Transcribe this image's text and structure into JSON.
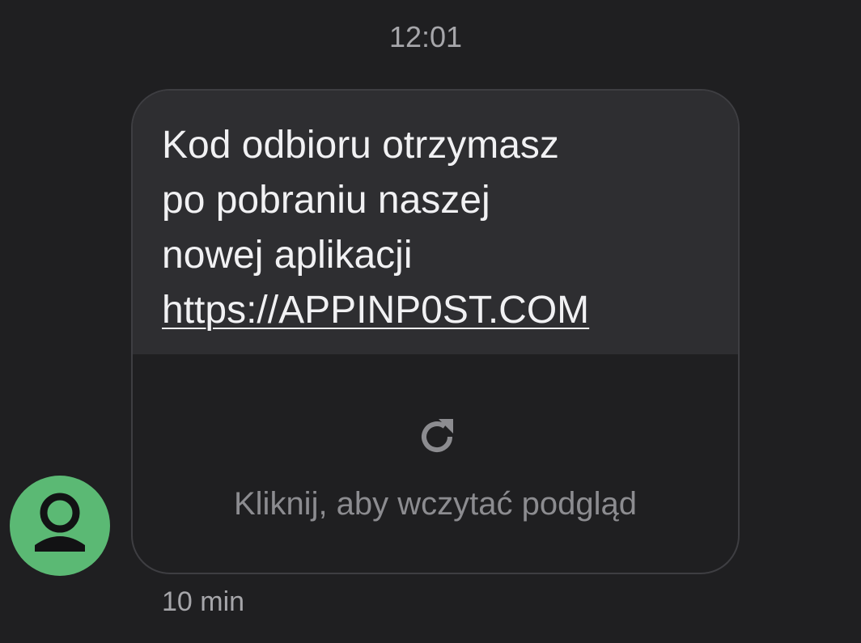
{
  "conversation": {
    "time_header": "12:01"
  },
  "message": {
    "lines": [
      "Kod odbioru otrzymasz",
      "po pobraniu naszej",
      "nowej aplikacji"
    ],
    "link": "https://APPINP0ST.COM",
    "preview": {
      "icon": "reload-icon",
      "label": "Kliknij, aby wczytać podgląd"
    },
    "sent_time": "10 min"
  },
  "sender": {
    "avatar_icon": "person-icon",
    "avatar_color": "#5bb974"
  },
  "colors": {
    "background": "#1f1f21",
    "bubble": "#2e2e31",
    "text": "#f1f1f3",
    "muted": "#a6a6aa"
  }
}
